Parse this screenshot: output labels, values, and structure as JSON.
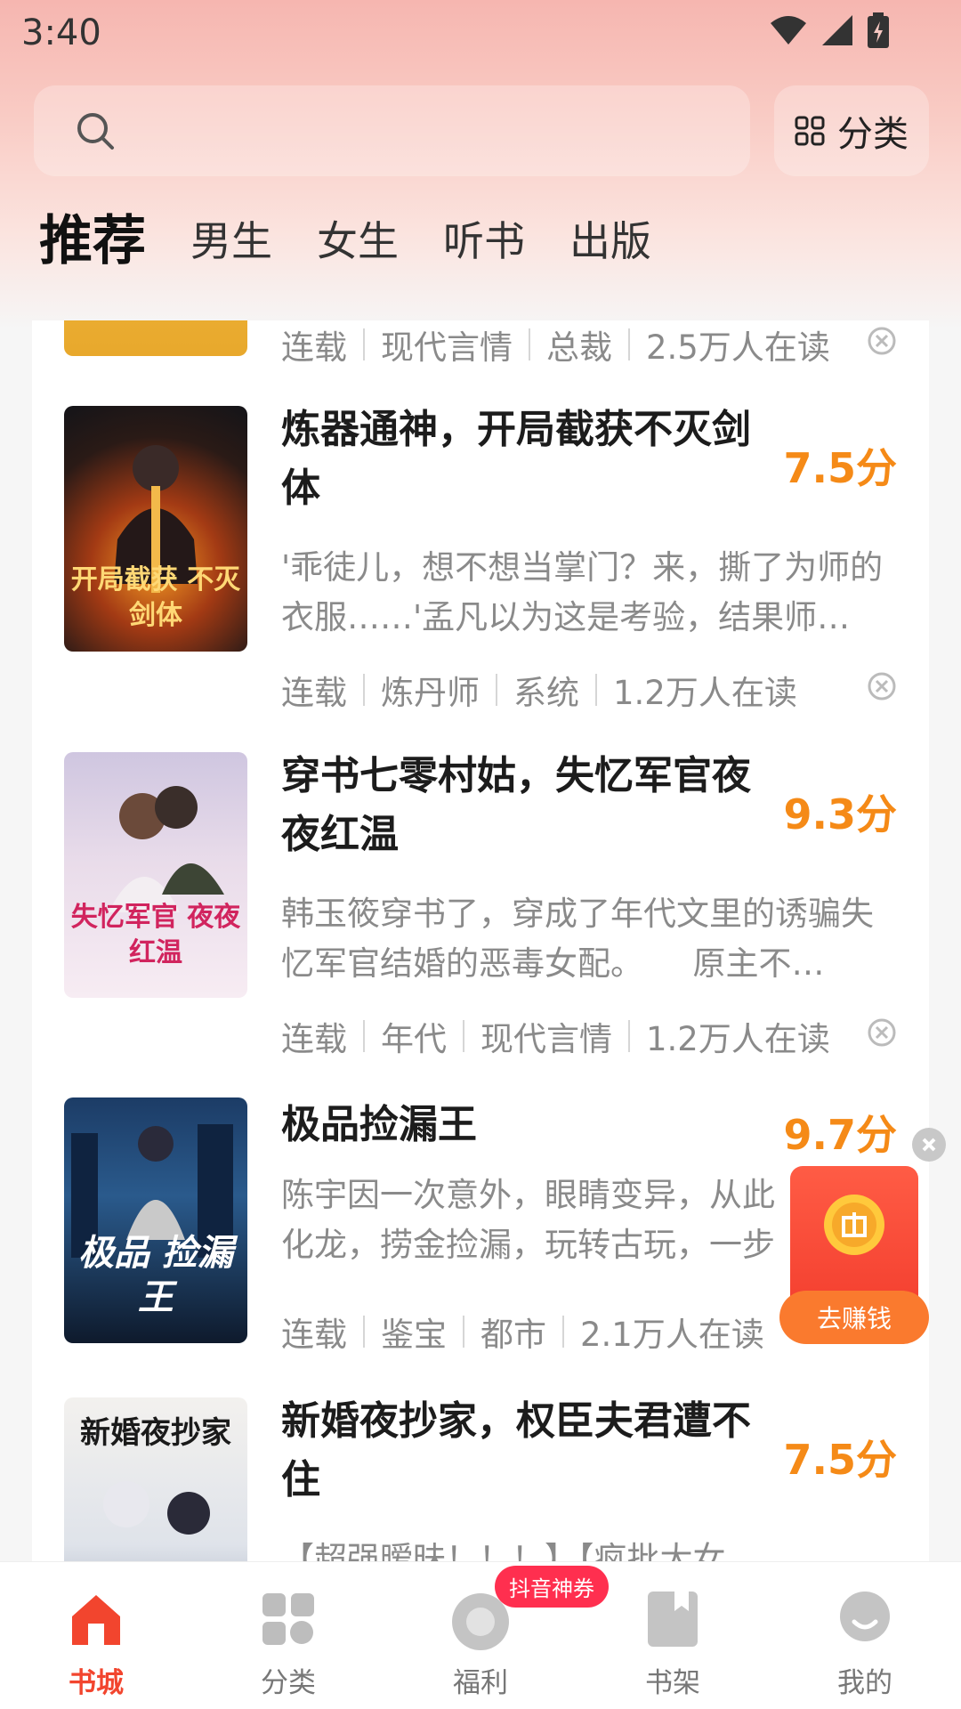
{
  "status_bar": {
    "time": "3:40"
  },
  "search": {
    "placeholder": ""
  },
  "category_button": {
    "label": "分类"
  },
  "tabs": [
    {
      "label": "推荐",
      "active": true
    },
    {
      "label": "男生"
    },
    {
      "label": "女生"
    },
    {
      "label": "听书"
    },
    {
      "label": "出版"
    }
  ],
  "books": [
    {
      "title": "",
      "score": "",
      "desc": "",
      "meta": [
        "连载",
        "现代言情",
        "总裁",
        "2.5万人在读"
      ]
    },
    {
      "title": "炼器通神，开局截获不灭剑体",
      "score": "7.5分",
      "desc": "'乖徒儿，想不想当掌门？来，撕了为师的衣服……'孟凡以为这是考验，结果师…",
      "meta": [
        "连载",
        "炼丹师",
        "系统",
        "1.2万人在读"
      ],
      "cover_text": "开局截获 不灭剑体"
    },
    {
      "title": "穿书七零村姑，失忆军官夜夜红温",
      "score": "9.3分",
      "desc": "韩玉筱穿书了，穿成了年代文里的诱骗失忆军官结婚的恶毒女配。　　原主不…",
      "meta": [
        "连载",
        "年代",
        "现代言情",
        "1.2万人在读"
      ],
      "cover_text": "失忆军官 夜夜红温"
    },
    {
      "title": "极品捡漏王",
      "score": "9.7分",
      "desc": "陈宇因一次意外，眼睛变异，从此化龙，捞金捡漏，玩转古玩，一步",
      "meta": [
        "连载",
        "鉴宝",
        "都市",
        "2.1万人在读"
      ],
      "cover_text": "极品 捡漏王"
    },
    {
      "title": "新婚夜抄家，权臣夫君遭不住",
      "score": "7.5分",
      "desc": "【超强暧昧！！！】【疯批大女",
      "meta": [],
      "cover_text": "新婚夜抄家"
    }
  ],
  "reward": {
    "label": "去赚钱"
  },
  "bottom_nav": [
    {
      "label": "书城",
      "active": true
    },
    {
      "label": "分类"
    },
    {
      "label": "福利",
      "badge": "抖音神券"
    },
    {
      "label": "书架"
    },
    {
      "label": "我的"
    }
  ],
  "colors": {
    "accent": "#f2452e",
    "score": "#f58a17",
    "reward": "#f23b2c"
  }
}
